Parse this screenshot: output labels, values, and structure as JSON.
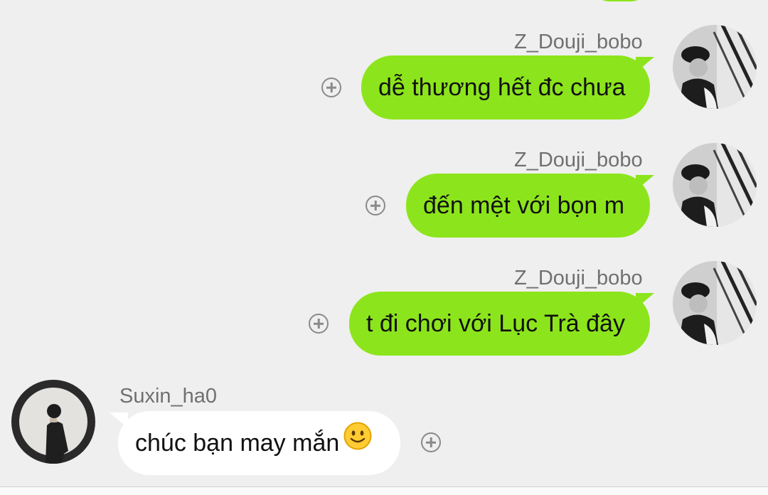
{
  "colors": {
    "background": "#efefef",
    "outgoing_bubble": "#8ce51c",
    "incoming_bubble": "#ffffff",
    "name_text": "#707070"
  },
  "messages": [
    {
      "sender": "Z_Douji_bobo",
      "text": "dễ thương hết đc chưa",
      "direction": "outgoing"
    },
    {
      "sender": "Z_Douji_bobo",
      "text": "đến mệt với bọn m",
      "direction": "outgoing"
    },
    {
      "sender": "Z_Douji_bobo",
      "text": "t đi chơi với Lục Trà đây",
      "direction": "outgoing"
    },
    {
      "sender": "Suxin_ha0",
      "text": "chúc bạn may mắn",
      "direction": "incoming",
      "emoji": "slightly-smiling-face"
    }
  ],
  "icons": {
    "add": "plus-circle-icon",
    "avatar_outgoing": "avatar-z-douji-bobo",
    "avatar_incoming": "avatar-suxin-ha0"
  }
}
